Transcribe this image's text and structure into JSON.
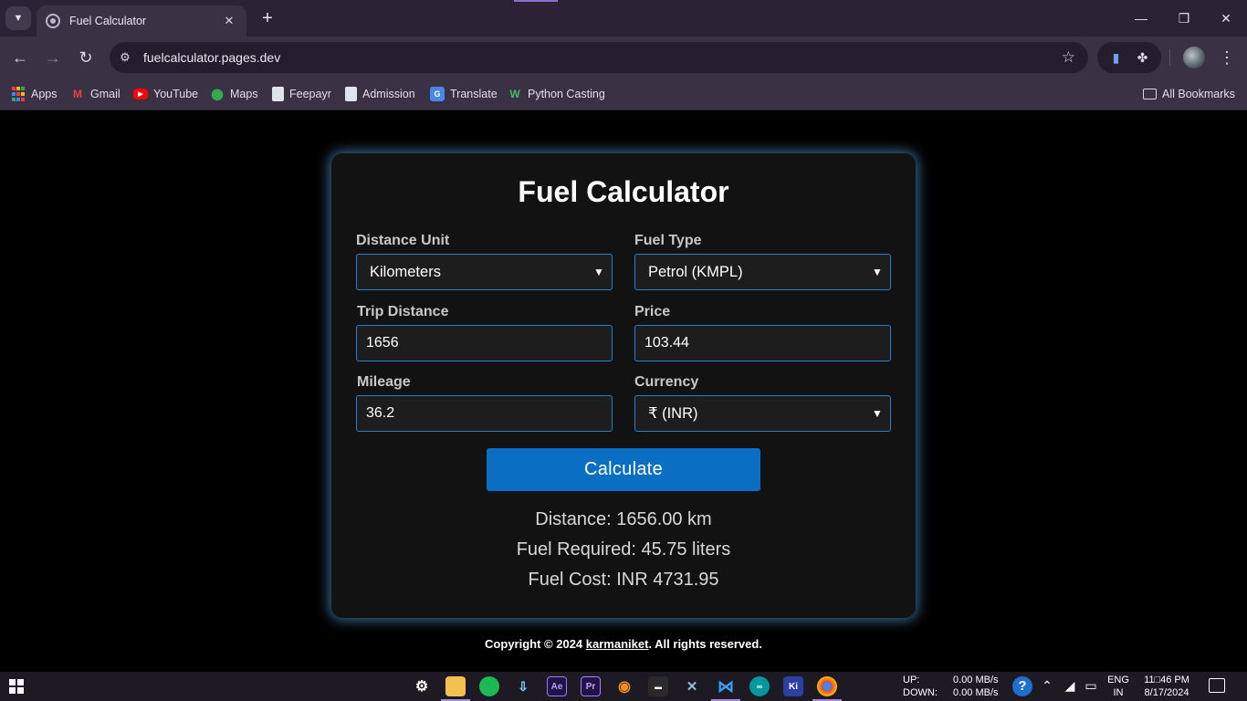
{
  "browser": {
    "tab_title": "Fuel Calculator",
    "tab_close": "✕",
    "new_tab": "+",
    "window_controls": {
      "minimize": "—",
      "restore": "❐",
      "close": "✕"
    },
    "nav": {
      "back": "←",
      "forward": "→",
      "reload": "↻"
    },
    "url": "fuelcalculator.pages.dev",
    "bookmarks": [
      {
        "label": "Apps",
        "icon": "apps-grid-icon"
      },
      {
        "label": "Gmail",
        "icon": "gmail-icon"
      },
      {
        "label": "YouTube",
        "icon": "youtube-icon"
      },
      {
        "label": "Maps",
        "icon": "maps-pin-icon"
      },
      {
        "label": "Feepayr",
        "icon": "document-icon"
      },
      {
        "label": "Admission",
        "icon": "document-icon"
      },
      {
        "label": "Translate",
        "icon": "translate-icon"
      },
      {
        "label": "Python Casting",
        "icon": "python-casting-icon"
      }
    ],
    "all_bookmarks": "All Bookmarks",
    "accent_color": "#3a3145"
  },
  "calculator": {
    "title": "Fuel Calculator",
    "distance_unit": {
      "label": "Distance Unit",
      "selected": "Kilometers"
    },
    "fuel_type": {
      "label": "Fuel Type",
      "selected": "Petrol (KMPL)"
    },
    "trip_distance": {
      "label": "Trip Distance",
      "value": "1656"
    },
    "price": {
      "label": "Price",
      "value": "103.44"
    },
    "mileage": {
      "label": "Mileage",
      "value": "36.2"
    },
    "currency": {
      "label": "Currency",
      "selected": "₹ (INR)"
    },
    "calculate_label": "Calculate",
    "button_color": "#0a6fc2",
    "results": {
      "distance": "Distance: 1656.00 km",
      "fuel_required": "Fuel Required: 45.75 liters",
      "fuel_cost": "Fuel Cost: INR 4731.95"
    }
  },
  "footer": {
    "prefix": "Copyright © 2024 ",
    "author": "karmaniket",
    "suffix": ". All rights reserved."
  },
  "taskbar": {
    "net_up_label": "UP:",
    "net_down_label": "DOWN:",
    "net_up_value": "0.00 MB/s",
    "net_down_value": "0.00 MB/s",
    "lang_top": "ENG",
    "lang_bottom": "IN",
    "time": "11□46 PM",
    "date": "8/17/2024"
  }
}
